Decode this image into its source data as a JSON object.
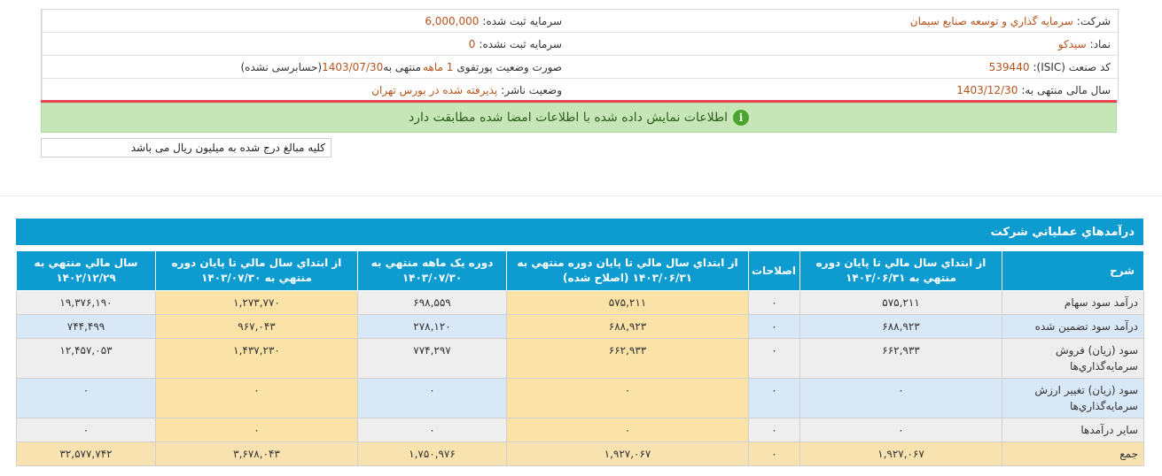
{
  "company_info": {
    "company_label": "شرکت:",
    "company_value": "سرمايه گذاري و توسعه صنايع سيمان",
    "symbol_label": "نماد:",
    "symbol_value": "سيدکو",
    "isic_label": "کد صنعت (ISIC):",
    "isic_value": "539440",
    "fiscal_year_label": "سال مالی منتهی به:",
    "fiscal_year_value": "1403/12/30",
    "registered_capital_label": "سرمايه ثبت شده:",
    "registered_capital_value": "6,000,000",
    "unregistered_capital_label": "سرمايه ثبت نشده:",
    "unregistered_capital_value": "0",
    "portfolio_label": "صورت وضعیت پورتفوی",
    "portfolio_value": "1 ماهه",
    "portfolio_suffix": "منتهی به",
    "portfolio_date": "1403/07/30",
    "portfolio_audit": "(حسابرسی نشده)",
    "publisher_label": "وضعیت ناشر:",
    "publisher_value": "پذیرفته شده در بورس تهران"
  },
  "notice": {
    "icon": "info-icon",
    "text": "اطلاعات نمایش داده شده با اطلاعات امضا شده مطابقت دارد"
  },
  "unit_note": "کلیه مبالغ درج شده به میلیون ریال می باشد",
  "section_title": "درآمدهاي عملياتي شرکت",
  "table": {
    "headers": [
      "شرح",
      "از ابتداي سال مالي تا پايان دوره منتهي به ۱۴۰۳/۰۶/۳۱",
      "اصلاحات",
      "از ابتداي سال مالي تا پايان دوره منتهي به ۱۴۰۳/۰۶/۳۱ (اصلاح شده)",
      "دوره يک ماهه منتهي به ۱۴۰۳/۰۷/۳۰",
      "از ابتداي سال مالي تا پايان دوره منتهي به ۱۴۰۳/۰۷/۳۰",
      "سال مالي منتهي به ۱۴۰۲/۱۲/۲۹"
    ],
    "rows": [
      [
        "درآمد سود سهام",
        "۵۷۵,۲۱۱",
        "۰",
        "۵۷۵,۲۱۱",
        "۶۹۸,۵۵۹",
        "۱,۲۷۳,۷۷۰",
        "۱۹,۳۷۶,۱۹۰"
      ],
      [
        "درآمد سود تضمين شده",
        "۶۸۸,۹۲۳",
        "۰",
        "۶۸۸,۹۲۳",
        "۲۷۸,۱۲۰",
        "۹۶۷,۰۴۳",
        "۷۴۴,۴۹۹"
      ],
      [
        "سود (زيان) فروش سرمايه‌گذاري‌ها",
        "۶۶۲,۹۳۳",
        "۰",
        "۶۶۲,۹۳۳",
        "۷۷۴,۲۹۷",
        "۱,۴۳۷,۲۳۰",
        "۱۲,۴۵۷,۰۵۳"
      ],
      [
        "سود (زيان) تغيير ارزش سرمايه‌گذاري‌ها",
        "۰",
        "۰",
        "۰",
        "۰",
        "۰",
        "۰"
      ],
      [
        "ساير درآمدها",
        "۰",
        "۰",
        "۰",
        "۰",
        "۰",
        "۰"
      ],
      [
        "جمع",
        "۱,۹۲۷,۰۶۷",
        "۰",
        "۱,۹۲۷,۰۶۷",
        "۱,۷۵۰,۹۷۶",
        "۳,۶۷۸,۰۴۳",
        "۳۲,۵۷۷,۷۴۲"
      ]
    ]
  },
  "colors": {
    "header_blue": "#0e9bd0",
    "highlight": "#fbe2a6",
    "notice_green": "#c6e6b8",
    "accent_red": "#e8444f"
  }
}
